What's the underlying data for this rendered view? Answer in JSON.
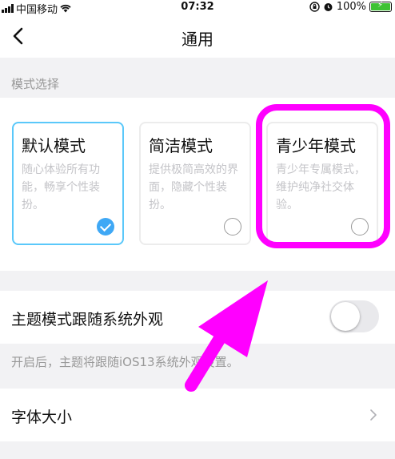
{
  "status_bar": {
    "carrier": "中国移动",
    "time": "07:32",
    "battery": "100%",
    "icons": [
      "signal-icon",
      "wifi-icon",
      "orientation-lock-icon",
      "alarm-icon",
      "battery-charging-icon"
    ]
  },
  "nav": {
    "title": "通用",
    "back_icon": "chevron-left-icon"
  },
  "mode_section": {
    "label": "模式选择",
    "modes": [
      {
        "name": "默认模式",
        "desc": "随心体验所有功能，畅享个性装扮。",
        "selected": true
      },
      {
        "name": "简洁模式",
        "desc": "提供极简高效的界面，隐藏个性装扮。",
        "selected": false
      },
      {
        "name": "青少年模式",
        "desc": "青少年专属模式，维护纯净社交体验。",
        "selected": false
      }
    ]
  },
  "theme": {
    "label": "主题模式跟随系统外观",
    "enabled": false,
    "hint": "开启后，主题将跟随iOS13系统外观设置。"
  },
  "font": {
    "label": "字体大小",
    "chevron_icon": "chevron-right-icon"
  },
  "annotation": {
    "color": "#ff00ff"
  }
}
